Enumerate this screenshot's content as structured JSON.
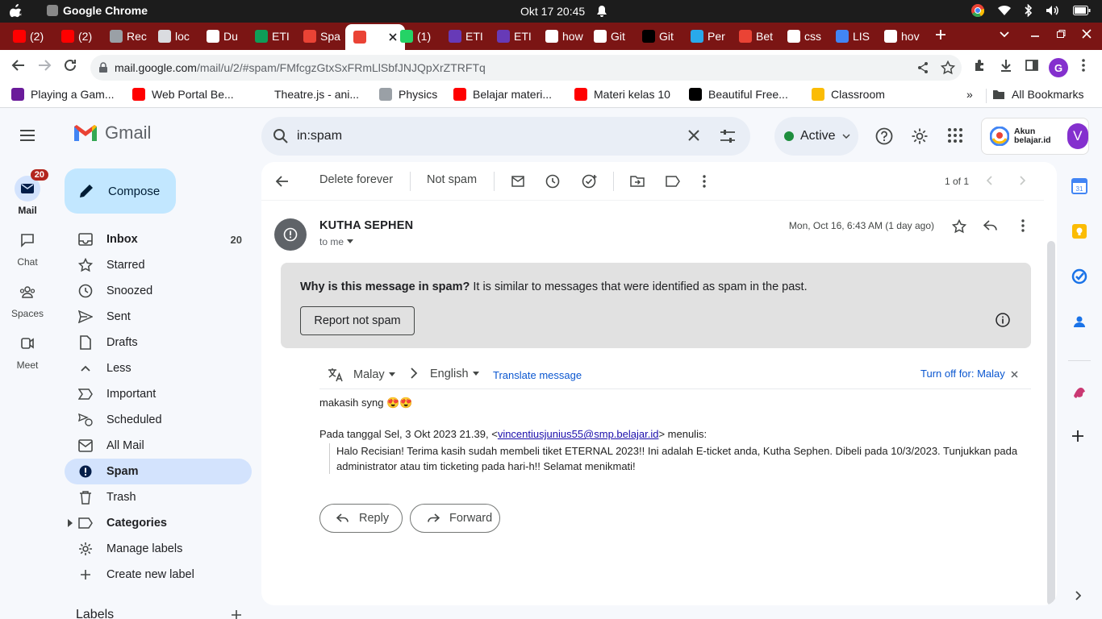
{
  "os": {
    "app_name": "Google Chrome",
    "clock": "Okt 17  20:45"
  },
  "tabs": [
    {
      "label": "(2)",
      "icon": "youtube-icon",
      "color": "#ff0000"
    },
    {
      "label": "(2)",
      "icon": "youtube-icon",
      "color": "#ff0000"
    },
    {
      "label": "Rec",
      "icon": "spinner-icon",
      "color": "#9aa0a6"
    },
    {
      "label": "loc",
      "icon": "globe-icon",
      "color": "#dadce0"
    },
    {
      "label": "Du",
      "icon": "github-icon",
      "color": "#ffffff"
    },
    {
      "label": "ETI",
      "icon": "sheets-icon",
      "color": "#0f9d58"
    },
    {
      "label": "Spa",
      "icon": "gmail-icon",
      "color": "#ea4335"
    },
    {
      "label": "",
      "icon": "gmail-icon",
      "color": "#ea4335",
      "active": true
    },
    {
      "label": "(1)",
      "icon": "whatsapp-icon",
      "color": "#25d366"
    },
    {
      "label": "ETI",
      "icon": "forms-icon",
      "color": "#673ab7"
    },
    {
      "label": "ETI",
      "icon": "forms-icon",
      "color": "#673ab7"
    },
    {
      "label": "how",
      "icon": "google-icon",
      "color": "#ffffff"
    },
    {
      "label": "Git",
      "icon": "github-icon",
      "color": "#ffffff"
    },
    {
      "label": "Git",
      "icon": "vercel-icon",
      "color": "#000000"
    },
    {
      "label": "Per",
      "icon": "telegram-icon",
      "color": "#29a9eb"
    },
    {
      "label": "Bet",
      "icon": "apps-icon",
      "color": "#ea4335"
    },
    {
      "label": "css",
      "icon": "google-icon",
      "color": "#ffffff"
    },
    {
      "label": "LIS",
      "icon": "docs-icon",
      "color": "#4285f4"
    },
    {
      "label": "hov",
      "icon": "google-icon",
      "color": "#ffffff"
    }
  ],
  "browser": {
    "url_host": "mail.google.com",
    "url_path": "/mail/u/2/#spam/FMfcgzGtxSxFRmLlSbfJNJQpXrZTRFTq",
    "profile_letter": "G"
  },
  "bookmarks": [
    {
      "label": "Playing a Gam...",
      "color": "#6a1b9a"
    },
    {
      "label": "Web Portal Be...",
      "color": "#ff0000"
    },
    {
      "label": "Theatre.js - ani...",
      "color": "#ffffff"
    },
    {
      "label": "Physics",
      "color": "#9aa0a6"
    },
    {
      "label": "Belajar materi...",
      "color": "#ff0000"
    },
    {
      "label": "Materi kelas 10",
      "color": "#ff0000"
    },
    {
      "label": "Beautiful Free...",
      "color": "#000000"
    },
    {
      "label": "Classroom",
      "color": "#fbbc04"
    }
  ],
  "bookmarks_more": "»",
  "all_bookmarks": "All Bookmarks",
  "gmail": {
    "logo_text": "Gmail",
    "search_value": "in:spam",
    "status": "Active",
    "account_label_1": "Akun",
    "account_label_2": "belajar.id",
    "avatar_letter": "V",
    "rail": [
      {
        "label": "Mail",
        "badge": "20"
      },
      {
        "label": "Chat"
      },
      {
        "label": "Spaces"
      },
      {
        "label": "Meet"
      }
    ],
    "compose": "Compose",
    "nav": [
      {
        "label": "Inbox",
        "count": "20"
      },
      {
        "label": "Starred"
      },
      {
        "label": "Snoozed"
      },
      {
        "label": "Sent"
      },
      {
        "label": "Drafts"
      },
      {
        "label": "Less"
      },
      {
        "label": "Important"
      },
      {
        "label": "Scheduled"
      },
      {
        "label": "All Mail"
      },
      {
        "label": "Spam"
      },
      {
        "label": "Trash"
      },
      {
        "label": "Categories"
      },
      {
        "label": "Manage labels"
      },
      {
        "label": "Create new label"
      }
    ],
    "labels_heading": "Labels",
    "toolbar": {
      "delete_forever": "Delete forever",
      "not_spam": "Not spam",
      "pager": "1 of 1"
    },
    "message": {
      "sender": "KUTHA SEPHEN",
      "to": "to me",
      "date": "Mon, Oct 16, 6:43 AM (1 day ago)",
      "warning_bold": "Why is this message in spam?",
      "warning_text": " It is similar to messages that were identified as spam in the past.",
      "report_button": "Report not spam",
      "translate_from": "Malay",
      "translate_to": "English",
      "translate_link": "Translate message",
      "turn_off": "Turn off for: Malay",
      "body_line": "makasih syng 😍😍",
      "quote_intro_pre": "Pada tanggal Sel, 3 Okt 2023 21.39, <",
      "quote_email": "vincentiusjunius55@smp.belajar.id",
      "quote_intro_post": "> menulis:",
      "quote_text": "Halo Recisian! Terima kasih sudah membeli tiket ETERNAL 2023!! Ini adalah E-ticket anda, Kutha Sephen. Dibeli pada 10/3/2023. Tunjukkan pada administrator atau tim ticketing pada hari-h!! Selamat menikmati!",
      "reply": "Reply",
      "forward": "Forward"
    }
  },
  "colors": {
    "tabstrip": "#7b1514",
    "accent_selected": "#d3e3fd",
    "compose": "#c2e7ff",
    "spam_warning_bg": "#e1e1e1"
  }
}
